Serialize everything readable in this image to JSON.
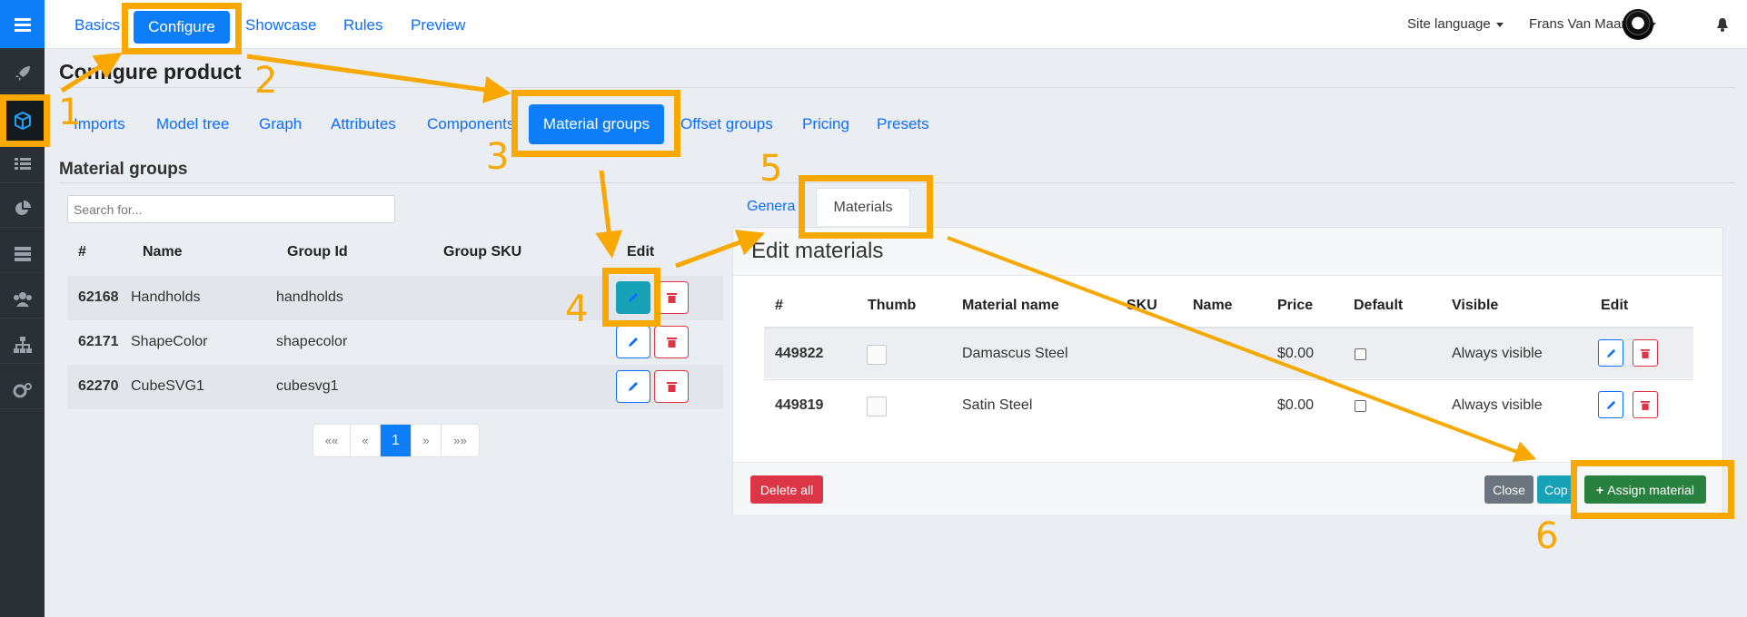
{
  "topnav": {
    "basics": "Basics",
    "configure": "Configure",
    "showcase": "Showcase",
    "rules": "Rules",
    "preview": "Preview"
  },
  "header": {
    "site_language": "Site language",
    "user_name": "Frans Van Maanen"
  },
  "page_title": "Configure product",
  "subtabs": [
    "Imports",
    "Model tree",
    "Graph",
    "Attributes",
    "Components",
    "Material groups",
    "Offset groups",
    "Pricing",
    "Presets"
  ],
  "material_groups": {
    "title": "Material groups",
    "search_placeholder": "Search for...",
    "columns": [
      "#",
      "Name",
      "Group Id",
      "Group SKU",
      "Edit"
    ],
    "rows": [
      {
        "id": "62168",
        "name": "Handholds",
        "group_id": "handholds",
        "group_sku": ""
      },
      {
        "id": "62171",
        "name": "ShapeColor",
        "group_id": "shapecolor",
        "group_sku": ""
      },
      {
        "id": "62270",
        "name": "CubeSVG1",
        "group_id": "cubesvg1",
        "group_sku": ""
      }
    ],
    "pager": {
      "first": "««",
      "prev": "«",
      "current": "1",
      "next": "»",
      "last": "»»"
    }
  },
  "edit_panel": {
    "tabs": {
      "general": "Genera",
      "materials": "Materials"
    },
    "title": "Edit materials",
    "columns": [
      "#",
      "Thumb",
      "Material name",
      "SKU",
      "Name",
      "Price",
      "Default",
      "Visible",
      "Edit"
    ],
    "rows": [
      {
        "id": "449822",
        "material_name": "Damascus Steel",
        "sku": "",
        "name": "",
        "price": "$0.00",
        "default": false,
        "visible": "Always visible"
      },
      {
        "id": "449819",
        "material_name": "Satin Steel",
        "sku": "",
        "name": "",
        "price": "$0.00",
        "default": false,
        "visible": "Always visible"
      }
    ],
    "footer": {
      "delete_all": "Delete all",
      "close": "Close",
      "copy": "Cop",
      "assign": "Assign material"
    }
  },
  "annotations": [
    "1",
    "2",
    "3",
    "4",
    "5",
    "6"
  ],
  "colors": {
    "primary": "#0d7df8",
    "annotation": "#f8a800",
    "danger": "#dc3545",
    "success": "#28813e",
    "info": "#17a2b8",
    "secondary": "#6c757d",
    "sidebar": "#2b3036"
  },
  "icons": [
    "menu-icon",
    "rocket-icon",
    "cube-icon",
    "list-icon",
    "pie-chart-icon",
    "server-icon",
    "users-icon",
    "sitemap-icon",
    "gears-icon",
    "bell-icon",
    "pencil-icon",
    "trash-icon",
    "image-icon",
    "plus-icon"
  ]
}
